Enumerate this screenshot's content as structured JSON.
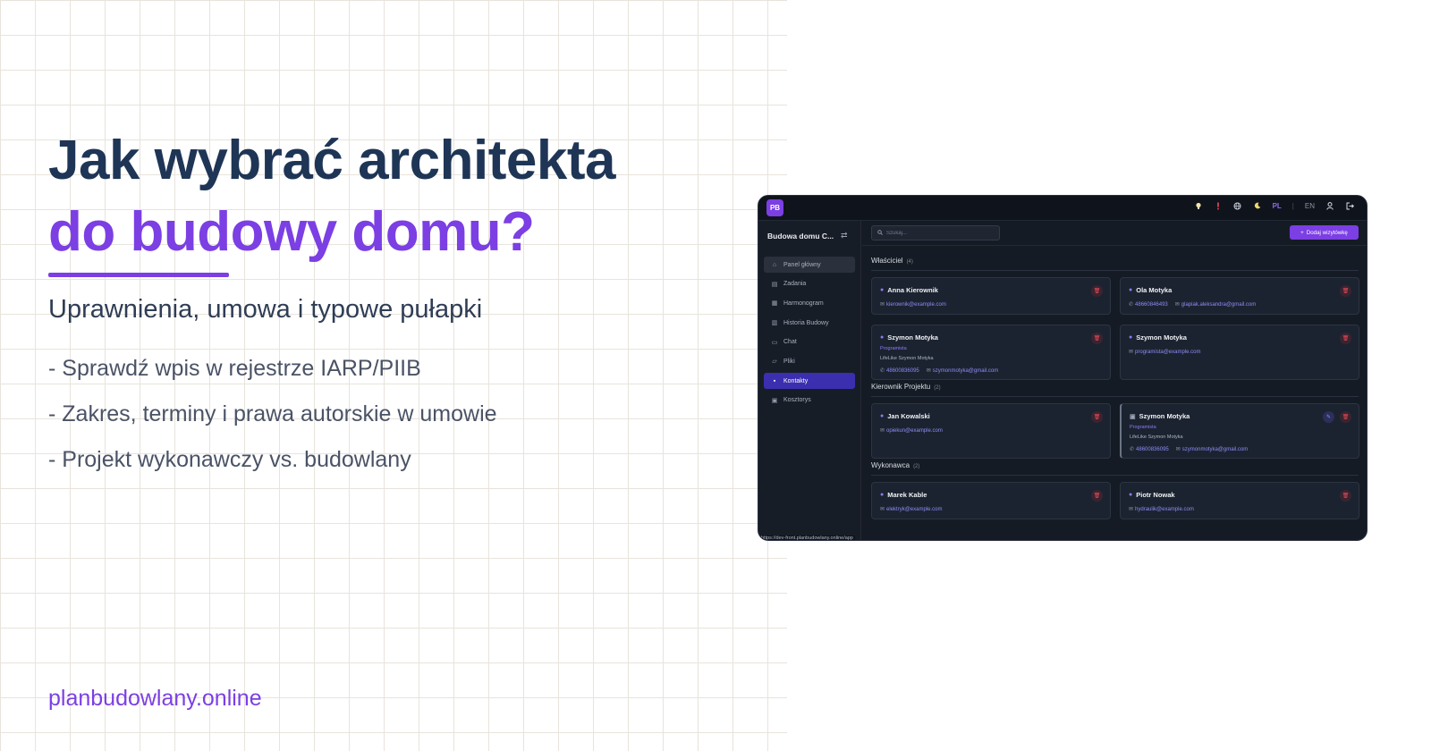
{
  "hero": {
    "title_line1": "Jak wybrać architekta",
    "title_line2": "do budowy domu?",
    "subtitle": "Uprawnienia, umowa i typowe pułapki",
    "bullets": [
      "- Sprawdź wpis w rejestrze IARP/PIIB",
      "- Zakres, terminy i prawa autorskie w umowie",
      "- Projekt wykonawczy vs. budowlany"
    ],
    "site": "planbudowlany.online"
  },
  "colors": {
    "title_dark": "#1e3556",
    "accent": "#7b3fe4",
    "app_bg": "#151b24",
    "active_nav": "#3b2fb0",
    "delete_red": "#ef4b5b"
  },
  "app": {
    "logo_text": "PB",
    "topbar": {
      "icons": [
        "lightbulb-icon",
        "alert-icon",
        "globe-icon",
        "moon-icon",
        "user-icon",
        "logout-icon"
      ],
      "lang_pl": "PL",
      "lang_en": "EN"
    },
    "sidebar": {
      "project_name": "Budowa domu C...",
      "items": [
        {
          "label": "Panel główny",
          "icon": "home-icon"
        },
        {
          "label": "Zadania",
          "icon": "clipboard-icon"
        },
        {
          "label": "Harmonogram",
          "icon": "calendar-icon"
        },
        {
          "label": "Historia Budowy",
          "icon": "book-icon"
        },
        {
          "label": "Chat",
          "icon": "chat-icon"
        },
        {
          "label": "Pliki",
          "icon": "folder-icon"
        },
        {
          "label": "Kontakty",
          "icon": "contacts-icon"
        },
        {
          "label": "Kosztorys",
          "icon": "calculator-icon"
        }
      ],
      "status_url": "https://dev-front.planbudowlany.online/app"
    },
    "search": {
      "placeholder": "Szukaj..."
    },
    "add_button": "Dodaj wizytówkę",
    "sections": [
      {
        "title": "Właściciel",
        "count": "(4)",
        "cards": [
          {
            "name": "Anna Kierownik",
            "email": "kierownik@example.com"
          },
          {
            "name": "Ola Motyka",
            "phone": "48660846493",
            "email": "glapiak.aleksandra@gmail.com"
          },
          {
            "name": "Szymon Motyka",
            "role": "Programista",
            "company": "LifeLike Szymon Motyka",
            "phone": "48600836095",
            "email": "szymonmotyka@gmail.com"
          },
          {
            "name": "Szymon Motyka",
            "email": "programista@example.com"
          }
        ]
      },
      {
        "title": "Kierownik Projektu",
        "count": "(2)",
        "cards": [
          {
            "name": "Jan Kowalski",
            "email": "opiekun@example.com"
          },
          {
            "name": "Szymon Motyka",
            "role": "Programista",
            "company": "LifeLike Szymon Motyka",
            "phone": "48600836095",
            "email": "szymonmotyka@gmail.com"
          }
        ]
      },
      {
        "title": "Wykonawca",
        "count": "(2)",
        "cards": [
          {
            "name": "Marek Kable",
            "email": "elektryk@example.com"
          },
          {
            "name": "Piotr Nowak",
            "email": "hydraulik@example.com"
          }
        ]
      }
    ]
  }
}
